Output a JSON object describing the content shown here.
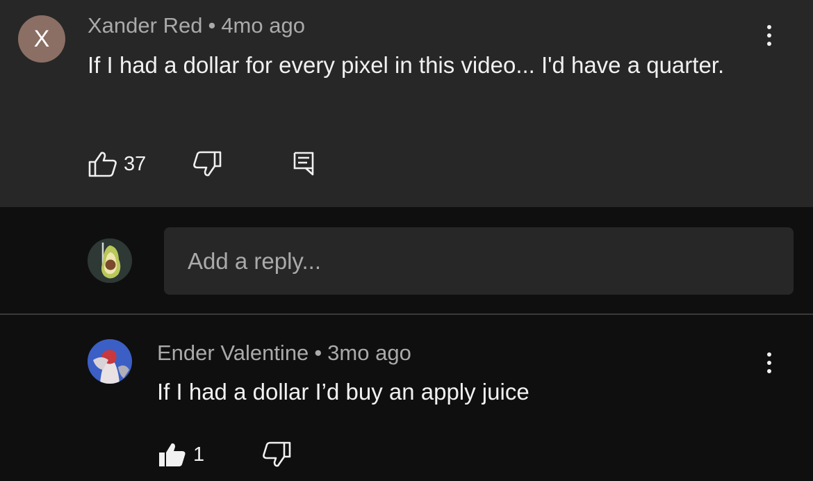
{
  "comment_main": {
    "avatar_letter": "X",
    "author": "Xander Red",
    "separator": "•",
    "time": "4mo ago",
    "text": "If I had a dollar for every pixel in this video... I'd have a quarter.",
    "like_count": "37",
    "icons": {
      "like": "thumbs-up-outline-icon",
      "dislike": "thumbs-down-outline-icon",
      "reply": "reply-comment-icon",
      "menu": "more-vertical-icon"
    }
  },
  "reply_box": {
    "placeholder": "Add a reply...",
    "avatar_icon": "avocado-avatar-icon"
  },
  "comment_reply": {
    "author": "Ender Valentine",
    "separator": "•",
    "time": "3mo ago",
    "text": "If I had a dollar I’d buy an apply juice",
    "like_count": "1",
    "icons": {
      "like": "thumbs-up-filled-icon",
      "dislike": "thumbs-down-outline-icon",
      "menu": "more-vertical-icon"
    }
  },
  "colors": {
    "page_bg": "#0f0f0f",
    "highlight_bg": "#272727",
    "text_primary": "#f1f1f1",
    "text_secondary": "#aaaaaa",
    "avatar_x_bg": "#8b6f64"
  }
}
